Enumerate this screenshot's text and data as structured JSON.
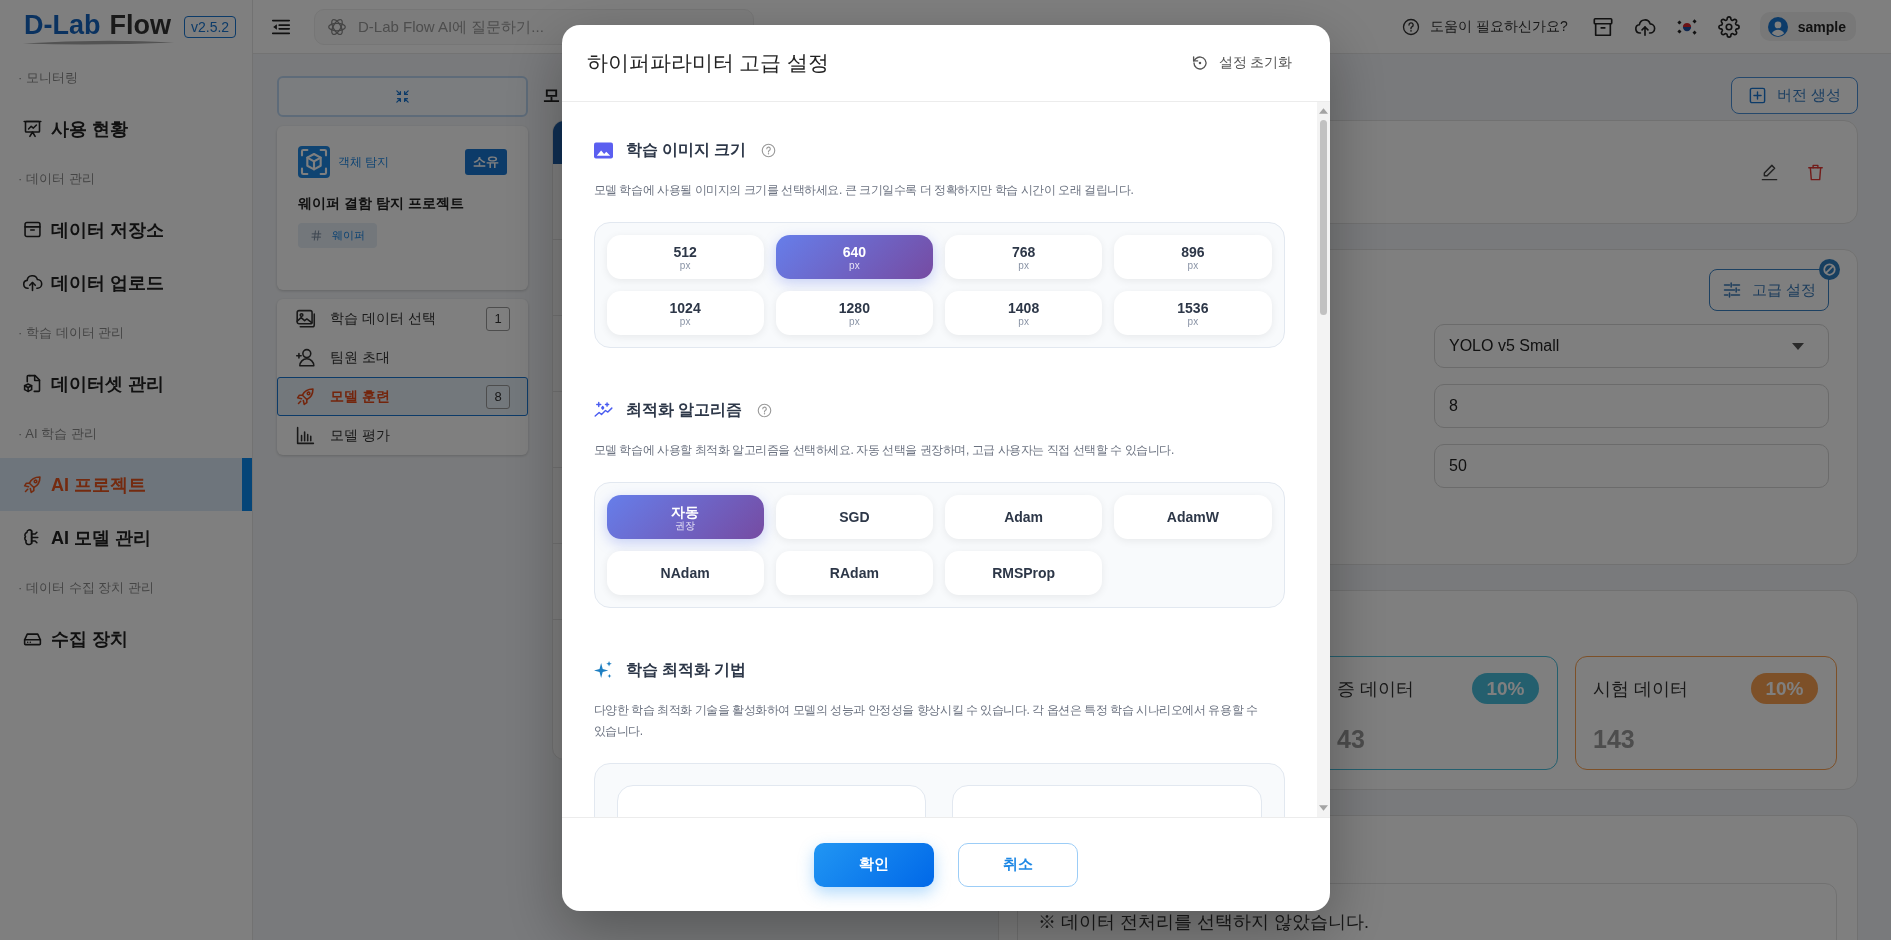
{
  "sidebar": {
    "logo": {
      "prefix": "D-Lab",
      "name": "Flow"
    },
    "version": "v2.5.2",
    "groups": [
      {
        "title": "· 모니터링",
        "items": [
          {
            "label": "사용 현황",
            "selected": false
          }
        ]
      },
      {
        "title": "· 데이터 관리",
        "items": [
          {
            "label": "데이터 저장소",
            "selected": false
          },
          {
            "label": "데이터 업로드",
            "selected": false
          }
        ]
      },
      {
        "title": "· 학습 데이터 관리",
        "items": [
          {
            "label": "데이터셋 관리",
            "selected": false
          }
        ]
      },
      {
        "title": "· AI 학습 관리",
        "items": [
          {
            "label": "AI 프로젝트",
            "selected": true
          },
          {
            "label": "AI 모델 관리",
            "selected": false
          }
        ]
      },
      {
        "title": "· 데이터 수집 장치 관리",
        "items": [
          {
            "label": "수집 장치",
            "selected": false
          }
        ]
      }
    ]
  },
  "topbar": {
    "search": {
      "placeholder": "D-Lab Flow AI에 질문하기..."
    },
    "help": "도움이 필요하신가요?",
    "user": "sample"
  },
  "project_panel": {
    "project": {
      "type": "객체 탐지",
      "badge": "소유",
      "name": "웨이퍼 결함 탐지 프로젝트",
      "tags": [
        "웨이퍼"
      ]
    },
    "nav": [
      {
        "label": "학습 데이터 선택",
        "count": "1",
        "selected": false
      },
      {
        "label": "팀원 초대",
        "selected": false
      },
      {
        "label": "모델 훈련",
        "count": "8",
        "selected": true
      },
      {
        "label": "모델 평가",
        "selected": false
      }
    ]
  },
  "main": {
    "title": "모",
    "version_button": "버전 생성",
    "training": {
      "advanced_button": "고급 설정",
      "fields": [
        {
          "kind": "select",
          "value": "YOLO v5 Small"
        },
        {
          "kind": "input",
          "value": "8"
        },
        {
          "kind": "input",
          "value": "50"
        }
      ]
    },
    "split": [
      {
        "title": "증 데이터",
        "percent": "10%",
        "count": "43",
        "color": "#245f6e"
      },
      {
        "title": "시험 데이터",
        "percent": "10%",
        "count": "143",
        "color": "#7d5028"
      }
    ],
    "preprocessing_note": "※ 데이터 전처리를 선택하지 않았습니다."
  },
  "modal": {
    "title": "하이퍼파라미터 고급 설정",
    "reset": "설정 초기화",
    "sections": [
      {
        "kind": "image_size",
        "title": "학습 이미지 크기",
        "help": true,
        "description": "모델 학습에 사용될 이미지의 크기를 선택하세요. 큰 크기일수록 더 정확하지만 학습 시간이 오래 걸립니다.",
        "options": [
          {
            "label": "512",
            "unit": "px",
            "selected": false
          },
          {
            "label": "640",
            "unit": "px",
            "selected": true
          },
          {
            "label": "768",
            "unit": "px",
            "selected": false
          },
          {
            "label": "896",
            "unit": "px",
            "selected": false
          },
          {
            "label": "1024",
            "unit": "px",
            "selected": false
          },
          {
            "label": "1280",
            "unit": "px",
            "selected": false
          },
          {
            "label": "1408",
            "unit": "px",
            "selected": false
          },
          {
            "label": "1536",
            "unit": "px",
            "selected": false
          }
        ]
      },
      {
        "kind": "optimizer",
        "title": "최적화 알고리즘",
        "help": true,
        "description": "모델 학습에 사용할 최적화 알고리즘을 선택하세요. 자동 선택을 권장하며, 고급 사용자는 직접 선택할 수 있습니다.",
        "options": [
          {
            "label": "자동",
            "note": "권장",
            "selected": true
          },
          {
            "label": "SGD",
            "selected": false
          },
          {
            "label": "Adam",
            "selected": false
          },
          {
            "label": "AdamW",
            "selected": false
          },
          {
            "label": "NAdam",
            "selected": false
          },
          {
            "label": "RAdam",
            "selected": false
          },
          {
            "label": "RMSProp",
            "selected": false
          }
        ]
      },
      {
        "kind": "techniques",
        "title": "학습 최적화 기법",
        "help": false,
        "description": "다양한 학습 최적화 기술을 활성화하여 모델의 성능과 안정성을 향상시킬 수 있습니다. 각 옵션은 특정 학습 시나리오에서 유용할 수 있습니다."
      }
    ],
    "buttons": [
      {
        "label": "확인",
        "kind": "primary"
      },
      {
        "label": "취소",
        "kind": "secondary"
      }
    ]
  }
}
